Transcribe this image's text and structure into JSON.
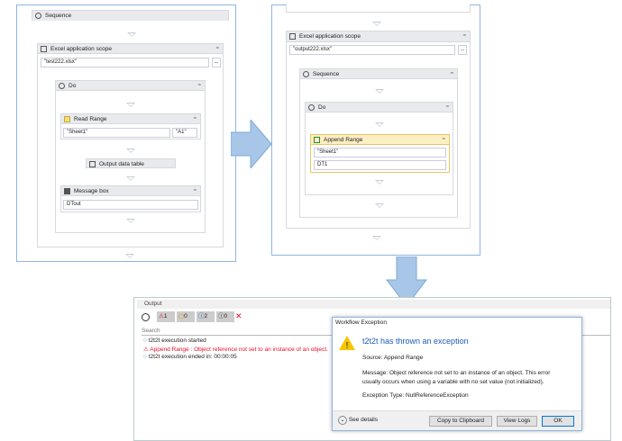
{
  "left_workflow": {
    "sequence": "Sequence",
    "excel_scope": "Excel application scope",
    "workbook": "\"test222.xlsx\"",
    "browse": "...",
    "do": "Do",
    "read_range": "Read Range",
    "sheet": "\"Sheet1\"",
    "range": "\"A1\"",
    "output_data_table": "Output data table",
    "message_box": "Message box",
    "message_value": "DTout"
  },
  "right_workflow": {
    "excel_scope": "Excel application scope",
    "workbook": "\"output222.xlsx\"",
    "browse": "...",
    "sequence": "Sequence",
    "do": "Do",
    "append_range": "Append Range",
    "sheet": "\"Sheet1\"",
    "datatable": "DT1"
  },
  "output": {
    "title": "Output",
    "counts": {
      "errors": "1",
      "warnings": "0",
      "info": "2",
      "trace": "0"
    },
    "search_placeholder": "Search",
    "logs": [
      {
        "type": "info",
        "text": "t2t2t execution started"
      },
      {
        "type": "error",
        "text": "Append Range : Object reference not set to an instance of an object."
      },
      {
        "type": "info",
        "text": "t2t2t execution ended in: 00:00:05"
      }
    ]
  },
  "dialog": {
    "title": "Workflow Exception",
    "heading": "t2t2t has thrown an exception",
    "source": "Source: Append Range",
    "message": "Message: Object reference not set to an instance of an object. This error usually occurs when using a variable with no set value (not initialized).",
    "exception_type": "Exception Type: NullReferenceException",
    "see_details": "See details",
    "copy": "Copy to Clipboard",
    "view_logs": "View Logs",
    "ok": "OK"
  },
  "colors": {
    "accent": "#8fb4e3",
    "error": "#e81123",
    "heading": "#1e5bb8",
    "append_bg": "#fdefc4"
  }
}
